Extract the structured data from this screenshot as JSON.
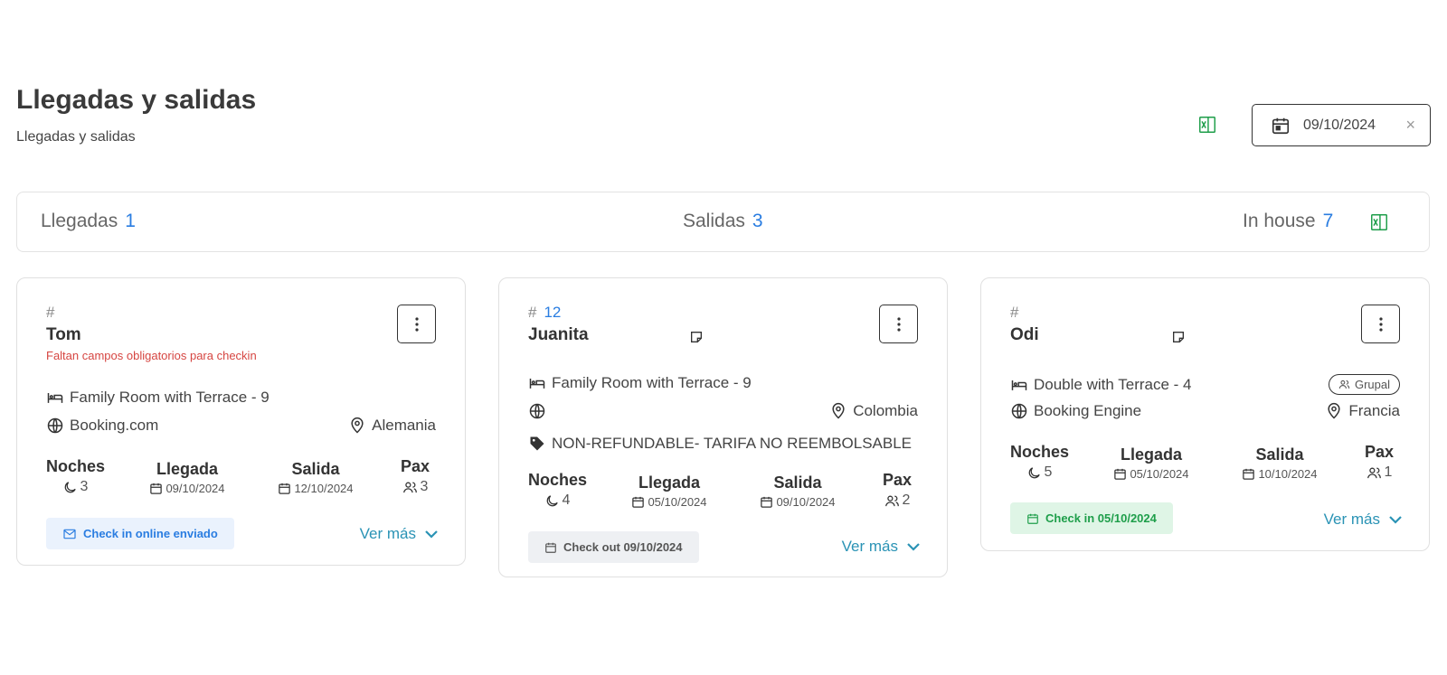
{
  "page": {
    "title": "Llegadas y salidas",
    "subtitle": "Llegadas y salidas"
  },
  "date_filter": {
    "value": "09/10/2024",
    "clear": "×"
  },
  "summary": {
    "llegadas_label": "Llegadas",
    "llegadas_count": "1",
    "salidas_label": "Salidas",
    "salidas_count": "3",
    "inhouse_label": "In house",
    "inhouse_count": "7"
  },
  "labels": {
    "hash": "#",
    "noches": "Noches",
    "llegada": "Llegada",
    "salida": "Salida",
    "pax": "Pax",
    "ver_mas": "Ver más"
  },
  "cards": [
    {
      "number": "",
      "guest": "Tom",
      "warning": "Faltan campos obligatorios para checkin",
      "room": "Family Room with Terrace - 9",
      "channel": "Booking.com",
      "country": "Alemania",
      "noches": "3",
      "llegada": "09/10/2024",
      "salida": "12/10/2024",
      "pax": "3",
      "badge": "Check in online enviado"
    },
    {
      "number": "12",
      "guest": "Juanita",
      "room": "Family Room with Terrace - 9",
      "channel": "",
      "country": "Colombia",
      "rate": "NON-REFUNDABLE- TARIFA NO REEMBOLSABLE",
      "noches": "4",
      "llegada": "05/10/2024",
      "salida": "09/10/2024",
      "pax": "2",
      "badge": "Check out 09/10/2024"
    },
    {
      "number": "",
      "guest": "Odi",
      "group": "Grupal",
      "room": "Double with Terrace - 4",
      "channel": "Booking Engine",
      "country": "Francia",
      "noches": "5",
      "llegada": "05/10/2024",
      "salida": "10/10/2024",
      "pax": "1",
      "badge": "Check in 05/10/2024"
    }
  ],
  "colors": {
    "accent": "#2a7de1",
    "link": "#2a93b5",
    "excel": "#1e9e4a",
    "warning": "#d64541"
  }
}
